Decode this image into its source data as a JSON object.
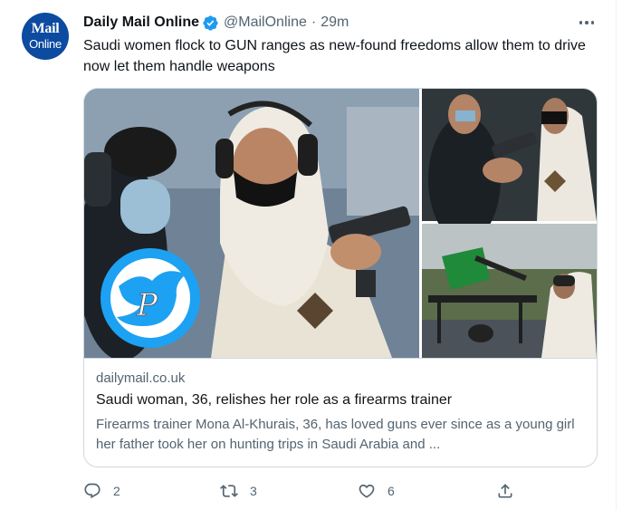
{
  "tweet": {
    "author": {
      "name": "Daily Mail Online",
      "handle": "@MailOnline",
      "avatar_text_top": "Mail",
      "avatar_text_bottom": "Online",
      "avatar_color": "#0c4ba0",
      "verified_color": "#1d9bf0"
    },
    "separator": "·",
    "time": "29m",
    "text": "Saudi women flock to GUN ranges as new-found freedoms allow them to drive now let them handle weapons",
    "card": {
      "domain": "dailymail.co.uk",
      "title": "Saudi woman, 36, relishes her role as a firearms trainer",
      "description": "Firearms trainer Mona Al-Khurais, 36, has loved guns ever since as a young girl her father took her on hunting trips in Saudi Arabia and ...",
      "watermark_icon": "twitter-bird-p-icon"
    },
    "actions": {
      "reply_count": "2",
      "retweet_count": "3",
      "like_count": "6"
    },
    "icons": [
      "verified-badge-icon",
      "more-options-icon",
      "reply-icon",
      "retweet-icon",
      "like-icon",
      "share-icon"
    ]
  }
}
